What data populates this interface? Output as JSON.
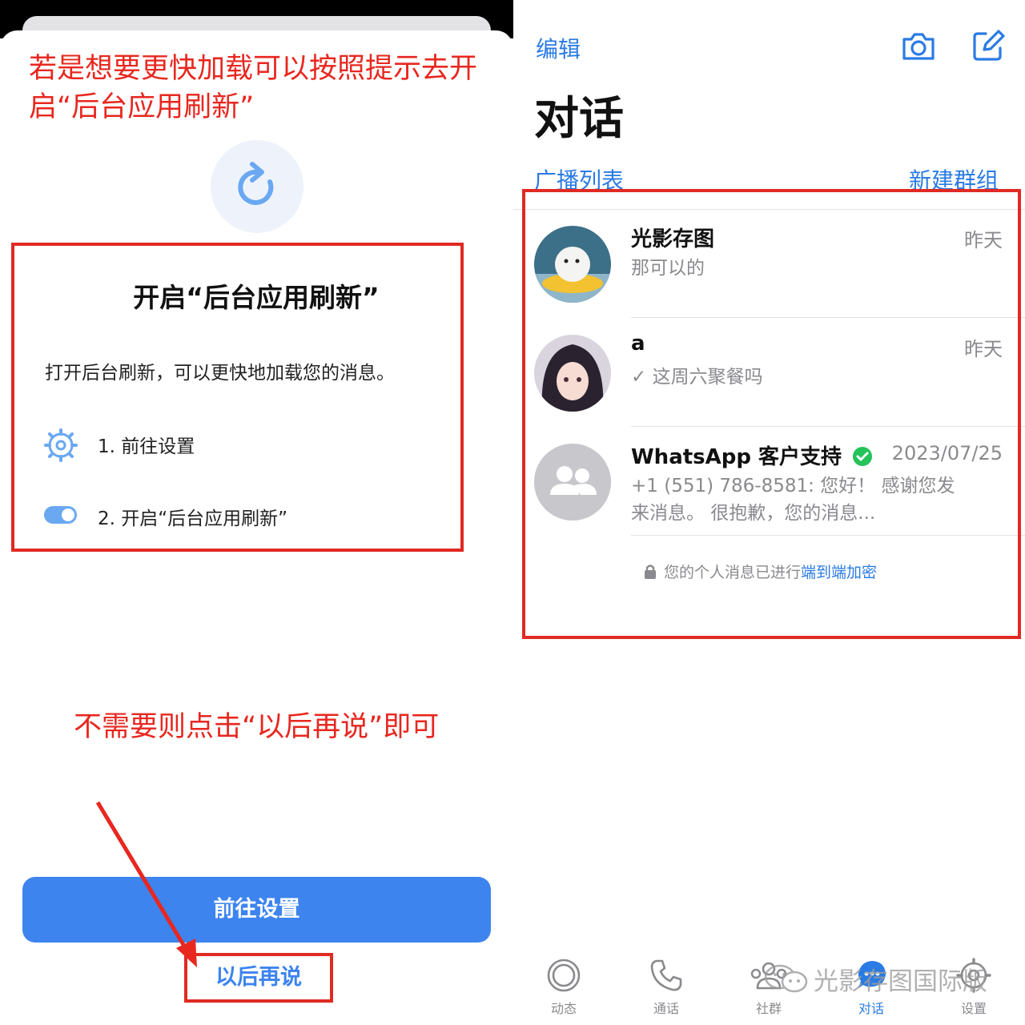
{
  "annotations": {
    "top": "若是想要更快加载可以按照提示去开启“后台应用刷新”",
    "bottom": "不需要则点击“以后再说”即可"
  },
  "dialog": {
    "title": "开启“后台应用刷新”",
    "description": "打开后台刷新，可以更快地加载您的消息。",
    "step1": "1. 前往设置",
    "step2": "2. 开启“后台应用刷新”",
    "primary_button": "前往设置",
    "secondary_button": "以后再说"
  },
  "header": {
    "edit": "编辑",
    "title": "对话",
    "broadcast": "广播列表",
    "new_group": "新建群组"
  },
  "chats": [
    {
      "name": "光影存图",
      "time": "昨天",
      "message": "那可以的"
    },
    {
      "name": "a",
      "time": "昨天",
      "message": "✓ 这周六聚餐吗"
    },
    {
      "name": "WhatsApp 客户支持",
      "time": "2023/07/25",
      "message": "+1 (551) 786-8581: 您好！ 感谢您发来消息。 很抱歉，您的消息..."
    }
  ],
  "encryption": {
    "prefix": "您的个人消息已进行",
    "link": "端到端加密"
  },
  "tabs": [
    {
      "label": "动态",
      "icon": "status-icon"
    },
    {
      "label": "通话",
      "icon": "phone-icon"
    },
    {
      "label": "社群",
      "icon": "community-icon"
    },
    {
      "label": "对话",
      "icon": "chats-icon"
    },
    {
      "label": "设置",
      "icon": "settings-icon"
    }
  ],
  "watermark": "光影存图国际版",
  "colors": {
    "accent": "#3d84ef",
    "link": "#2a7be4",
    "annotation": "#e8271f",
    "verified": "#25c35a"
  }
}
